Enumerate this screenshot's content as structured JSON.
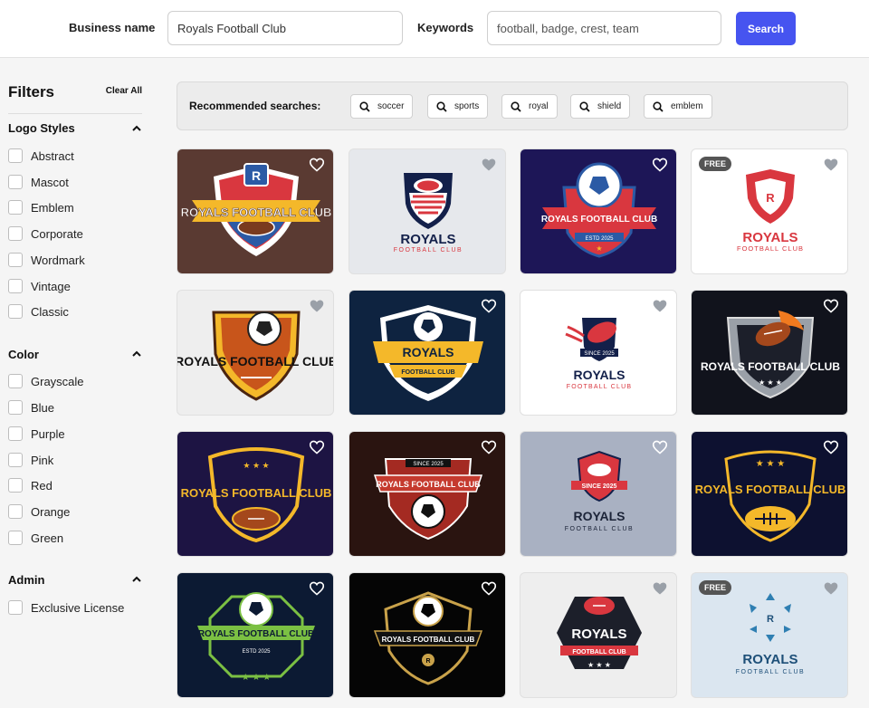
{
  "header": {
    "business_label": "Business name",
    "business_value": "Royals Football Club",
    "keywords_label": "Keywords",
    "keywords_placeholder": "football, badge, crest, team",
    "search_label": "Search"
  },
  "sidebar": {
    "title": "Filters",
    "clear_all": "Clear All",
    "logo_styles": {
      "title": "Logo Styles",
      "options": [
        "Abstract",
        "Mascot",
        "Emblem",
        "Corporate",
        "Wordmark",
        "Vintage",
        "Classic"
      ]
    },
    "color": {
      "title": "Color",
      "options": [
        "Grayscale",
        "Blue",
        "Purple",
        "Pink",
        "Red",
        "Orange",
        "Green"
      ]
    },
    "admin": {
      "title": "Admin",
      "options": [
        "Exclusive License"
      ]
    }
  },
  "recommended": {
    "label": "Recommended searches:",
    "chips": [
      "soccer",
      "sports",
      "royal",
      "shield",
      "emblem"
    ]
  },
  "logos": {
    "free_badge": "FREE",
    "r": "R",
    "royals": "ROYALS",
    "royals_football_club": "ROYALS FOOTBALL CLUB",
    "football_club": "FOOTBALL CLUB",
    "estd": "ESTD 2025",
    "since": "SINCE 2025",
    "colors": {
      "brown_bg": "#5a3a32",
      "navy": "#13204a",
      "red": "#d9373f",
      "yellow": "#f4b82a",
      "green": "#7bc043",
      "blue": "#2b5aa5",
      "indigo_bg": "#1d1657",
      "dark_bg": "#11131c"
    }
  }
}
